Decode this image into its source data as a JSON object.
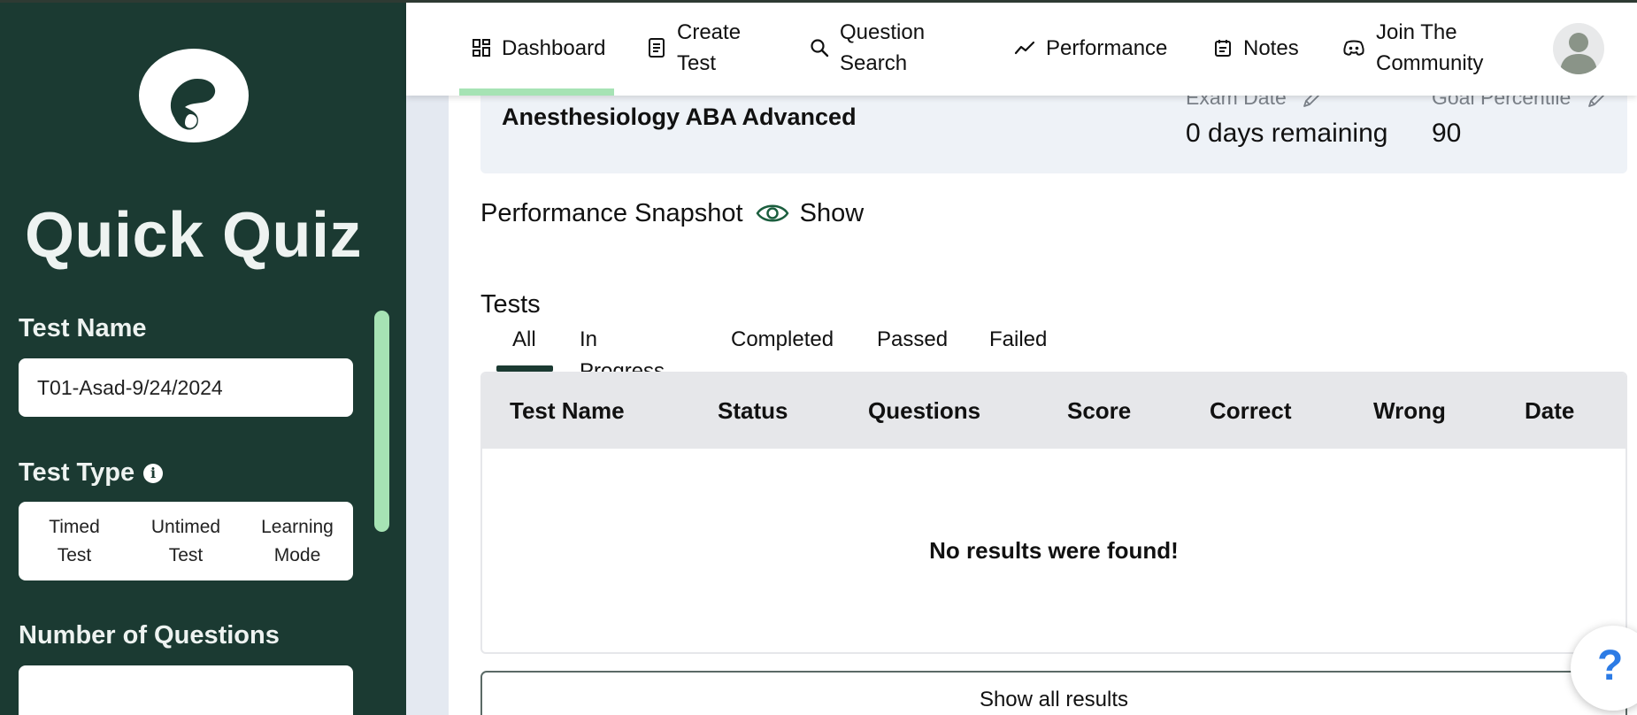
{
  "sidebar": {
    "title": "Quick Quiz",
    "test_name_label": "Test Name",
    "test_name_value": "T01-Asad-9/24/2024",
    "test_type_label": "Test Type",
    "test_types": [
      {
        "line1": "Timed",
        "line2": "Test"
      },
      {
        "line1": "Untimed",
        "line2": "Test"
      },
      {
        "line1": "Learning",
        "line2": "Mode"
      }
    ],
    "num_questions_label": "Number of Questions",
    "num_questions_value": ""
  },
  "nav": {
    "items": [
      {
        "line1": "Dashboard",
        "line2": "",
        "icon": "dashboard-icon"
      },
      {
        "line1": "Create",
        "line2": "Test",
        "icon": "document-icon"
      },
      {
        "line1": "Question",
        "line2": "Search",
        "icon": "search-icon"
      },
      {
        "line1": "Performance",
        "line2": "",
        "icon": "trend-line-icon"
      },
      {
        "line1": "Notes",
        "line2": "",
        "icon": "calendar-notes-icon"
      },
      {
        "line1": "Join The",
        "line2": "Community",
        "icon": "discord-icon"
      }
    ],
    "active_index": 0
  },
  "exam": {
    "name": "Anesthesiology ABA Advanced",
    "exam_date_label": "Exam Date",
    "exam_date_value": "0 days remaining",
    "goal_label": "Goal Percentile",
    "goal_value": "90"
  },
  "snapshot": {
    "label": "Performance Snapshot",
    "toggle_label": "Show"
  },
  "tests": {
    "title": "Tests",
    "tabs": [
      "All",
      "In Progress",
      "Completed",
      "Passed",
      "Failed"
    ],
    "active_tab": 0,
    "columns": [
      "Test Name",
      "Status",
      "Questions",
      "Score",
      "Correct",
      "Wrong",
      "Date"
    ],
    "rows": [],
    "empty_message": "No results were found!",
    "show_all_label": "Show all results"
  },
  "help": {
    "label": "?"
  },
  "colors": {
    "sidebar_bg": "#1b3a32",
    "accent_green": "#a6e3b4",
    "card_bg": "#eef2f7",
    "help_blue": "#2c7be5"
  }
}
